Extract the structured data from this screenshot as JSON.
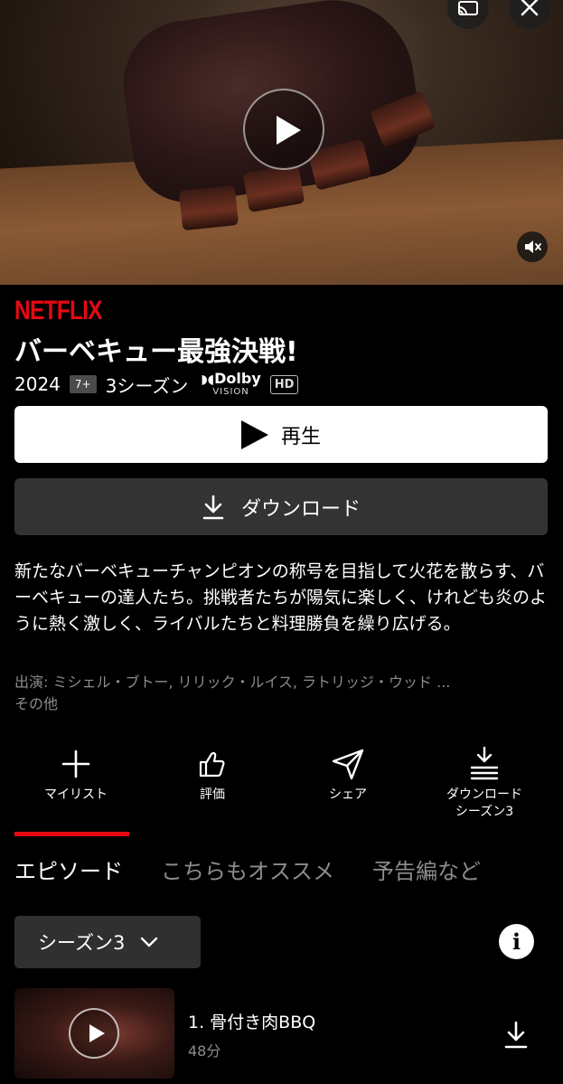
{
  "brand": {
    "logo_text": "NETFLIX",
    "accent": "#e50914"
  },
  "title": {
    "text": "バーベキュー最強決戦!"
  },
  "meta": {
    "year": "2024",
    "rating": "7+",
    "seasons": "3シーズン",
    "dolby_line1": "Dolby",
    "dolby_line2": "VISION",
    "quality": "HD"
  },
  "hero": {
    "icons": [
      "cast-icon",
      "close-icon",
      "play-icon",
      "mute-icon"
    ]
  },
  "buttons": {
    "play_label": "再生",
    "download_label": "ダウンロード"
  },
  "description": "新たなバーベキューチャンピオンの称号を目指して火花を散らす、バーベキューの達人たち。挑戦者たちが陽気に楽しく、けれども炎のように熱く激しく、ライバルたちと料理勝負を繰り広げる。",
  "cast": {
    "line1": "出演: ミシェル・ブトー, リリック・ルイス, ラトリッジ・ウッド ...",
    "line2": "その他"
  },
  "actions": {
    "my_list": "マイリスト",
    "rate": "評価",
    "share": "シェア",
    "download_line1": "ダウンロード",
    "download_line2": "シーズン3"
  },
  "tabs": {
    "episodes": "エピソード",
    "more_like_this": "こちらもオススメ",
    "trailers": "予告編など"
  },
  "season_selector": {
    "label": "シーズン3"
  },
  "episodes": [
    {
      "title": "1. 骨付き肉BBQ",
      "duration": "48分"
    }
  ]
}
